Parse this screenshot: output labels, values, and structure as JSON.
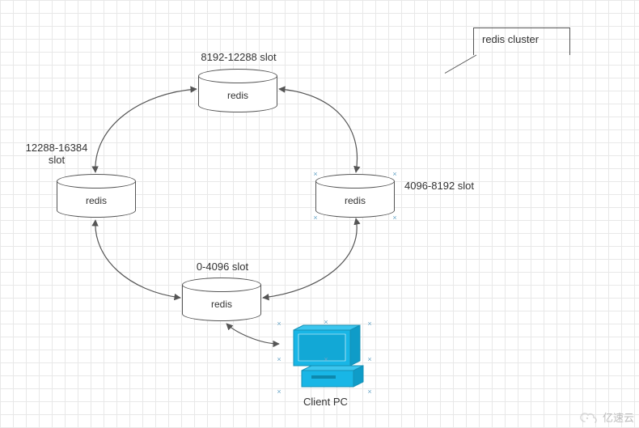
{
  "diagram": {
    "frame_title": "redis cluster",
    "nodes": {
      "top": {
        "label": "redis",
        "slot": "8192-12288 slot"
      },
      "right": {
        "label": "redis",
        "slot": "4096-8192 slot"
      },
      "bottom": {
        "label": "redis",
        "slot": "0-4096 slot"
      },
      "left": {
        "label": "redis",
        "slot": "12288-16384\nslot"
      }
    },
    "client": {
      "label": "Client PC"
    },
    "watermark": "亿速云"
  },
  "chart_data": {
    "type": "diagram",
    "title": "redis cluster",
    "nodes": [
      {
        "id": "redis-top",
        "type": "redis",
        "label": "redis",
        "slot_range": "8192-12288"
      },
      {
        "id": "redis-right",
        "type": "redis",
        "label": "redis",
        "slot_range": "4096-8192"
      },
      {
        "id": "redis-bottom",
        "type": "redis",
        "label": "redis",
        "slot_range": "0-4096"
      },
      {
        "id": "redis-left",
        "type": "redis",
        "label": "redis",
        "slot_range": "12288-16384"
      },
      {
        "id": "client-pc",
        "type": "client",
        "label": "Client PC"
      }
    ],
    "edges": [
      {
        "from": "redis-top",
        "to": "redis-right",
        "bidirectional": true
      },
      {
        "from": "redis-right",
        "to": "redis-bottom",
        "bidirectional": true
      },
      {
        "from": "redis-bottom",
        "to": "redis-left",
        "bidirectional": true
      },
      {
        "from": "redis-left",
        "to": "redis-top",
        "bidirectional": true
      },
      {
        "from": "client-pc",
        "to": "redis-bottom",
        "bidirectional": true
      }
    ]
  }
}
